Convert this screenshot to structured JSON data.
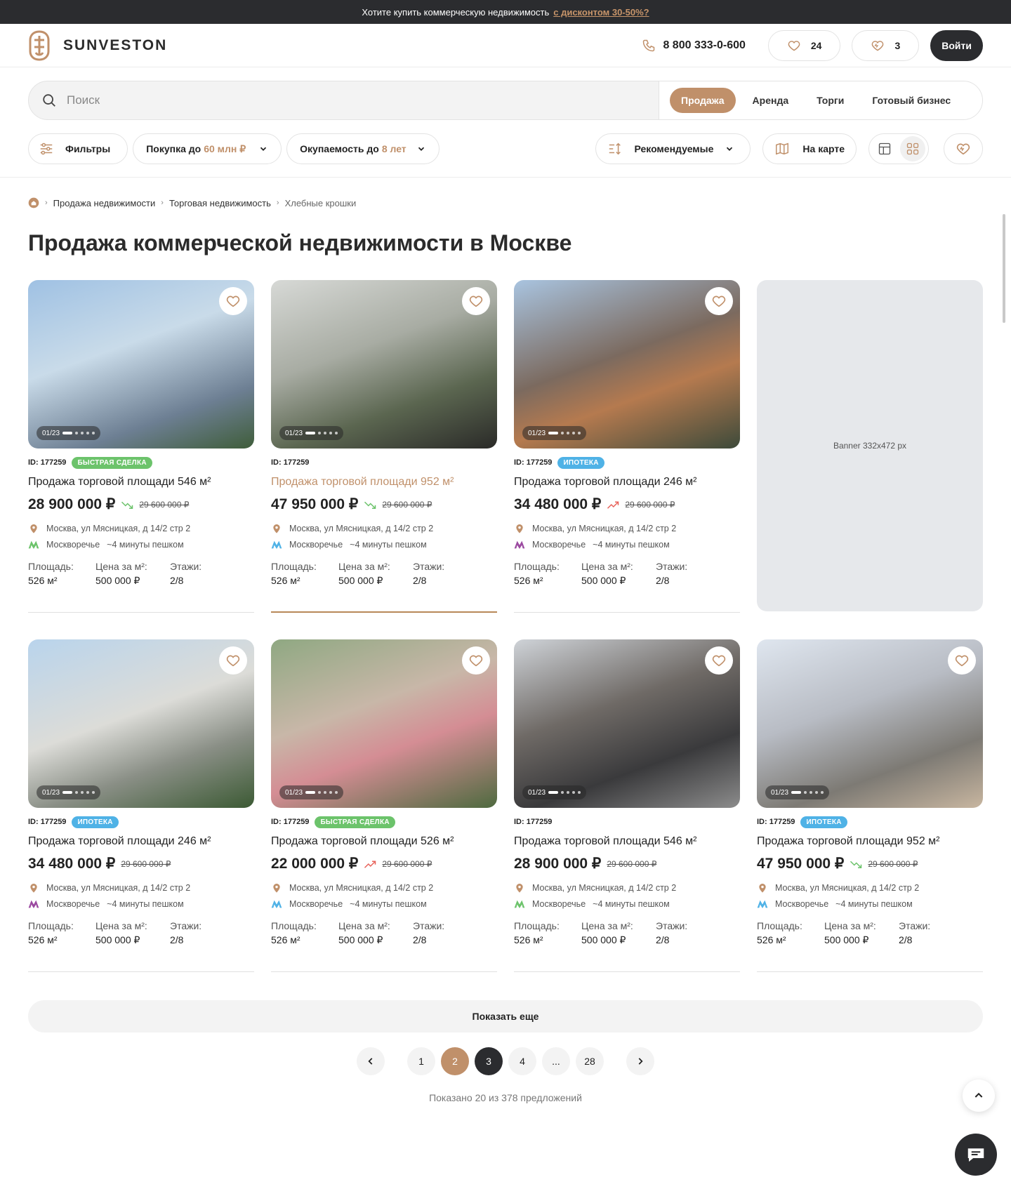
{
  "promo": {
    "text": "Хотите купить коммерческую недвижимость",
    "link": "с дисконтом 30-50%?"
  },
  "header": {
    "brand": "SUNVESTON",
    "phone": "8 800 333-0-600",
    "favorites_count": "24",
    "compare_count": "3",
    "login_label": "Войти"
  },
  "search": {
    "placeholder": "Поиск",
    "modes": [
      "Продажа",
      "Аренда",
      "Торги",
      "Готовый бизнес"
    ],
    "active_mode": "Продажа"
  },
  "filters": {
    "filters_label": "Фильтры",
    "budget_label": "Покупка до",
    "budget_value": "60 млн ₽",
    "payback_label": "Окупаемость до",
    "payback_value": "8 лет",
    "sort_label": "Рекомендуемые",
    "map_label": "На карте"
  },
  "breadcrumbs": [
    "Продажа недвижимости",
    "Торговая недвижимость",
    "Хлебные крошки"
  ],
  "page_title": "Продажа коммерческой недвижимости в Москве",
  "labels": {
    "area": "Площадь:",
    "price_per_m": "Цена за м²:",
    "floors": "Этажи:"
  },
  "banner_text": "Banner 332x472 px",
  "cards": [
    {
      "id": "ID: 177259",
      "badge": "Быстрая сделка",
      "title": "Продажа торговой площади 546 м²",
      "price": "28 900 000 ₽",
      "trend": "down",
      "old_price": "29 600 000 ₽",
      "address": "Москва, ул Мясницкая, д 14/2 стр 2",
      "metro": "Москворечье",
      "walk": "~4 минуты пешком",
      "area": "526 м²",
      "ppm": "500 000 ₽",
      "floors": "2/8",
      "photo_counter": "01/23",
      "metro_color": "#6cc36b"
    },
    {
      "id": "ID: 177259",
      "badge": "",
      "title": "Продажа торговой площади 952 м²",
      "price": "47 950 000 ₽",
      "trend": "down",
      "old_price": "29 600 000 ₽",
      "address": "Москва, ул Мясницкая, д 14/2 стр 2",
      "metro": "Москворечье",
      "walk": "~4 минуты пешком",
      "area": "526 м²",
      "ppm": "500 000 ₽",
      "floors": "2/8",
      "photo_counter": "01/23",
      "metro_color": "#4fb2e6"
    },
    {
      "id": "ID: 177259",
      "badge": "Ипотека",
      "title": "Продажа торговой площади 246 м²",
      "price": "34 480 000 ₽",
      "trend": "up",
      "old_price": "29 600 000 ₽",
      "address": "Москва, ул Мясницкая, д 14/2 стр 2",
      "metro": "Москворечье",
      "walk": "~4 минуты пешком",
      "area": "526 м²",
      "ppm": "500 000 ₽",
      "floors": "2/8",
      "photo_counter": "01/23",
      "metro_color": "#9b4aa0"
    },
    {
      "id": "ID: 177259",
      "badge": "Ипотека",
      "title": "Продажа торговой площади 246 м²",
      "price": "34 480 000 ₽",
      "trend": "",
      "old_price": "29 600 000 ₽",
      "address": "Москва, ул Мясницкая, д 14/2 стр 2",
      "metro": "Москворечье",
      "walk": "~4 минуты пешком",
      "area": "526 м²",
      "ppm": "500 000 ₽",
      "floors": "2/8",
      "photo_counter": "01/23",
      "metro_color": "#9b4aa0"
    },
    {
      "id": "ID: 177259",
      "badge": "Быстрая сделка",
      "title": "Продажа торговой площади 526 м²",
      "price": "22 000 000 ₽",
      "trend": "up",
      "old_price": "29 600 000 ₽",
      "address": "Москва, ул Мясницкая, д 14/2 стр 2",
      "metro": "Москворечье",
      "walk": "~4 минуты пешком",
      "area": "526 м²",
      "ppm": "500 000 ₽",
      "floors": "2/8",
      "photo_counter": "01/23",
      "metro_color": "#4fb2e6"
    },
    {
      "id": "ID: 177259",
      "badge": "",
      "title": "Продажа торговой площади 546 м²",
      "price": "28 900 000 ₽",
      "trend": "",
      "old_price": "29 600 000 ₽",
      "address": "Москва, ул Мясницкая, д 14/2 стр 2",
      "metro": "Москворечье",
      "walk": "~4 минуты пешком",
      "area": "526 м²",
      "ppm": "500 000 ₽",
      "floors": "2/8",
      "photo_counter": "01/23",
      "metro_color": "#6cc36b"
    },
    {
      "id": "ID: 177259",
      "badge": "Ипотека",
      "title": "Продажа торговой площади 952 м²",
      "price": "47 950 000 ₽",
      "trend": "down",
      "old_price": "29 600 000 ₽",
      "address": "Москва, ул Мясницкая, д 14/2 стр 2",
      "metro": "Москворечье",
      "walk": "~4 минуты пешком",
      "area": "526 м²",
      "ppm": "500 000 ₽",
      "floors": "2/8",
      "photo_counter": "01/23",
      "metro_color": "#4fb2e6"
    }
  ],
  "show_more": "Показать еще",
  "pagination": {
    "pages": [
      "1",
      "2",
      "3",
      "4",
      "...",
      "28"
    ],
    "current": "2",
    "hovered": "3"
  },
  "shown_text": "Показано 20 из 378 предложений",
  "colors": {
    "accent": "#c0906a",
    "dark": "#2b2c2f",
    "green": "#6cc36b",
    "blue": "#4fb2e6"
  }
}
